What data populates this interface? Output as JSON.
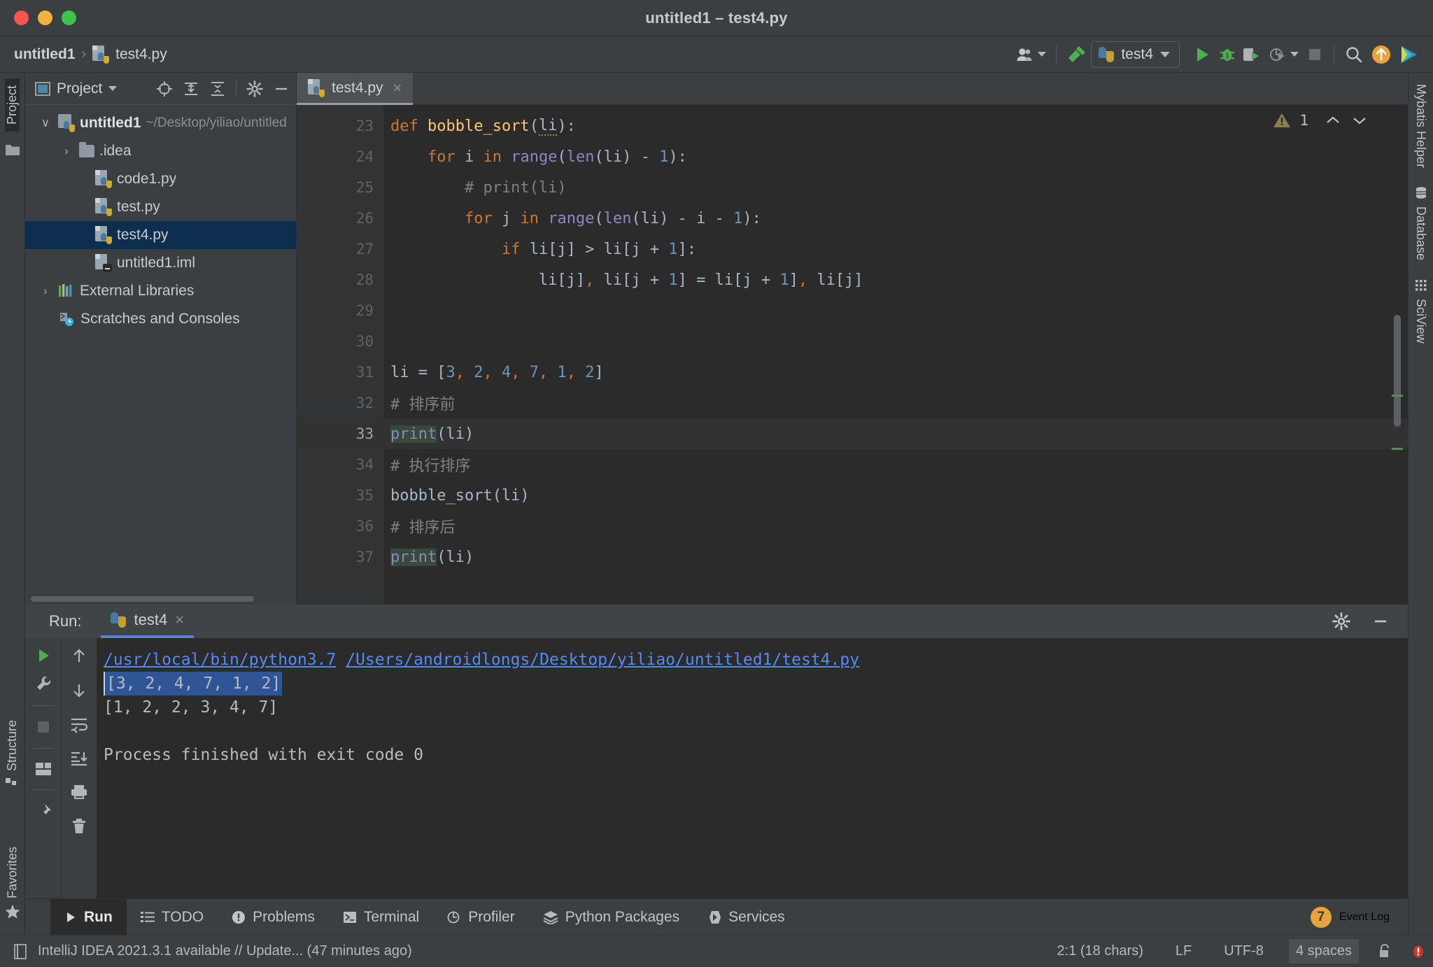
{
  "window": {
    "title": "untitled1 – test4.py",
    "traffic_lights": [
      "close",
      "minimize",
      "zoom"
    ]
  },
  "toolbar": {
    "breadcrumb": {
      "project": "untitled1",
      "separator": "›",
      "file": "test4.py"
    },
    "account_icon": "user-icon",
    "build_icon": "hammer-icon",
    "run_config": {
      "label": "test4",
      "icon": "python-icon"
    },
    "actions": [
      {
        "name": "run-button",
        "icon": "play-icon"
      },
      {
        "name": "debug-button",
        "icon": "bug-icon"
      },
      {
        "name": "run-coverage-button",
        "icon": "coverage-icon"
      },
      {
        "name": "profile-button",
        "icon": "profiler-icon"
      },
      {
        "name": "stop-button",
        "icon": "stop-icon"
      },
      {
        "name": "search-everywhere-button",
        "icon": "search-icon"
      },
      {
        "name": "update-project-button",
        "icon": "up-arrow-icon"
      },
      {
        "name": "plugin-button",
        "icon": "rainbow-icon"
      }
    ]
  },
  "left_tool_tabs": [
    {
      "label": "Project",
      "active": true
    },
    {
      "label": "Structure",
      "active": false
    },
    {
      "label": "Favorites",
      "active": false
    }
  ],
  "right_tool_tabs": [
    {
      "label": "Mybatis Helper",
      "icon": "none"
    },
    {
      "label": "Database",
      "icon": "database-icon"
    },
    {
      "label": "SciView",
      "icon": "grid-icon"
    }
  ],
  "project_panel": {
    "title": "Project",
    "icons": [
      "locate-icon",
      "expand-all-icon",
      "collapse-all-icon",
      "gear-icon",
      "hide-icon"
    ],
    "tree": [
      {
        "label": "untitled1",
        "path": "~/Desktop/yiliao/untitled",
        "icon": "python-module-icon",
        "arrow": "∨",
        "indent": 0,
        "bold": true,
        "selected": false
      },
      {
        "label": ".idea",
        "path": "",
        "icon": "folder-icon",
        "arrow": "›",
        "indent": 1,
        "bold": false,
        "selected": false
      },
      {
        "label": "code1.py",
        "path": "",
        "icon": "python-file-icon",
        "arrow": "",
        "indent": 2,
        "bold": false,
        "selected": false
      },
      {
        "label": "test.py",
        "path": "",
        "icon": "python-file-icon",
        "arrow": "",
        "indent": 2,
        "bold": false,
        "selected": false
      },
      {
        "label": "test4.py",
        "path": "",
        "icon": "python-file-icon",
        "arrow": "",
        "indent": 2,
        "bold": false,
        "selected": true
      },
      {
        "label": "untitled1.iml",
        "path": "",
        "icon": "iml-file-icon",
        "arrow": "",
        "indent": 2,
        "bold": false,
        "selected": false
      },
      {
        "label": "External Libraries",
        "path": "",
        "icon": "libraries-icon",
        "arrow": "›",
        "indent": 0,
        "bold": false,
        "selected": false
      },
      {
        "label": "Scratches and Consoles",
        "path": "",
        "icon": "scratches-icon",
        "arrow": "",
        "indent": 0,
        "bold": false,
        "selected": false
      }
    ]
  },
  "editor": {
    "tab": {
      "label": "test4.py",
      "icon": "python-file-icon",
      "close": "×"
    },
    "inspection": {
      "count": "1",
      "icon": "warning-icon",
      "up": "⌃",
      "down": "⌄"
    },
    "first_line_number": 23,
    "lines": [
      {
        "n": 23,
        "current": false,
        "fold": "minus",
        "tokens": [
          {
            "t": "def ",
            "c": "k"
          },
          {
            "t": "bobble_sort",
            "c": "fn"
          },
          {
            "t": "(",
            "c": "op"
          },
          {
            "t": "li",
            "c": "op sq"
          },
          {
            "t": "):",
            "c": "op"
          }
        ]
      },
      {
        "n": 24,
        "current": false,
        "fold": "minus",
        "tokens": [
          {
            "t": "    ",
            "c": "op"
          },
          {
            "t": "for",
            "c": "k"
          },
          {
            "t": " i ",
            "c": "op"
          },
          {
            "t": "in",
            "c": "k"
          },
          {
            "t": " ",
            "c": "op"
          },
          {
            "t": "range",
            "c": "bi"
          },
          {
            "t": "(",
            "c": "op"
          },
          {
            "t": "len",
            "c": "bi"
          },
          {
            "t": "(li) - ",
            "c": "op"
          },
          {
            "t": "1",
            "c": "num"
          },
          {
            "t": "):",
            "c": "op"
          }
        ]
      },
      {
        "n": 25,
        "current": false,
        "fold": "",
        "tokens": [
          {
            "t": "        # print(li)",
            "c": "cm"
          }
        ]
      },
      {
        "n": 26,
        "current": false,
        "fold": "minus",
        "tokens": [
          {
            "t": "        ",
            "c": "op"
          },
          {
            "t": "for",
            "c": "k"
          },
          {
            "t": " j ",
            "c": "op"
          },
          {
            "t": "in",
            "c": "k"
          },
          {
            "t": " ",
            "c": "op"
          },
          {
            "t": "range",
            "c": "bi"
          },
          {
            "t": "(",
            "c": "op"
          },
          {
            "t": "len",
            "c": "bi"
          },
          {
            "t": "(li) - i - ",
            "c": "op"
          },
          {
            "t": "1",
            "c": "num"
          },
          {
            "t": "):",
            "c": "op"
          }
        ]
      },
      {
        "n": 27,
        "current": false,
        "fold": "",
        "tokens": [
          {
            "t": "            ",
            "c": "op"
          },
          {
            "t": "if",
            "c": "k"
          },
          {
            "t": " li[j] > li[j + ",
            "c": "op"
          },
          {
            "t": "1",
            "c": "num"
          },
          {
            "t": "]:",
            "c": "op"
          }
        ]
      },
      {
        "n": 28,
        "current": false,
        "fold": "end",
        "tokens": [
          {
            "t": "                li[j]",
            "c": "op"
          },
          {
            "t": ",",
            "c": "cma"
          },
          {
            "t": " li[j + ",
            "c": "op"
          },
          {
            "t": "1",
            "c": "num"
          },
          {
            "t": "] = li[j + ",
            "c": "op"
          },
          {
            "t": "1",
            "c": "num"
          },
          {
            "t": "]",
            "c": "op"
          },
          {
            "t": ",",
            "c": "cma"
          },
          {
            "t": " li[j]",
            "c": "op"
          }
        ]
      },
      {
        "n": 29,
        "current": false,
        "fold": "",
        "tokens": []
      },
      {
        "n": 30,
        "current": false,
        "fold": "",
        "tokens": []
      },
      {
        "n": 31,
        "current": false,
        "fold": "",
        "tokens": [
          {
            "t": "li = [",
            "c": "op"
          },
          {
            "t": "3",
            "c": "num"
          },
          {
            "t": ",",
            "c": "cma"
          },
          {
            "t": " ",
            "c": "op"
          },
          {
            "t": "2",
            "c": "num"
          },
          {
            "t": ",",
            "c": "cma"
          },
          {
            "t": " ",
            "c": "op"
          },
          {
            "t": "4",
            "c": "num"
          },
          {
            "t": ",",
            "c": "cma"
          },
          {
            "t": " ",
            "c": "op"
          },
          {
            "t": "7",
            "c": "num"
          },
          {
            "t": ",",
            "c": "cma"
          },
          {
            "t": " ",
            "c": "op"
          },
          {
            "t": "1",
            "c": "num"
          },
          {
            "t": ",",
            "c": "cma"
          },
          {
            "t": " ",
            "c": "op"
          },
          {
            "t": "2",
            "c": "num"
          },
          {
            "t": "]",
            "c": "op"
          }
        ]
      },
      {
        "n": 32,
        "current": false,
        "fold": "",
        "tokens": [
          {
            "t": "# 排序前",
            "c": "cm"
          }
        ]
      },
      {
        "n": 33,
        "current": true,
        "fold": "",
        "tokens": [
          {
            "t": "print",
            "c": "bi hl"
          },
          {
            "t": "(li)",
            "c": "op"
          }
        ]
      },
      {
        "n": 34,
        "current": false,
        "fold": "",
        "tokens": [
          {
            "t": "# 执行排序",
            "c": "cm"
          }
        ]
      },
      {
        "n": 35,
        "current": false,
        "fold": "",
        "tokens": [
          {
            "t": "bobble_sort(li)",
            "c": "op"
          }
        ]
      },
      {
        "n": 36,
        "current": false,
        "fold": "",
        "tokens": [
          {
            "t": "# 排序后",
            "c": "cm"
          }
        ]
      },
      {
        "n": 37,
        "current": false,
        "fold": "",
        "tokens": [
          {
            "t": "print",
            "c": "bi hl"
          },
          {
            "t": "(li)",
            "c": "op"
          }
        ]
      }
    ]
  },
  "run_window": {
    "label": "Run:",
    "tab": {
      "label": "test4",
      "icon": "python-icon",
      "close": "×"
    },
    "header_icons": [
      "gear-icon",
      "hide-icon"
    ],
    "toolbar_left": [
      "rerun-icon",
      "wrench-icon",
      "stop-icon",
      "layout-icon",
      "pin-icon"
    ],
    "toolbar_right": [
      "up-icon",
      "down-icon",
      "soft-wrap-icon",
      "scroll-to-end-icon",
      "print-icon",
      "trash-icon"
    ],
    "console": {
      "command": "/usr/local/bin/python3.7 /Users/androidlongs/Desktop/yiliao/untitled1/test4.py",
      "command_parts": [
        "/usr/local/bin/python3.7",
        "/Users/androidlongs/Desktop/yiliao/untitled1/test4.py"
      ],
      "output_selected": "[3, 2, 4, 7, 1, 2]",
      "output_line2": "[1, 2, 2, 3, 4, 7]",
      "exit_message": "Process finished with exit code 0"
    }
  },
  "bottom_bar": {
    "buttons": [
      {
        "label": "Run",
        "icon": "play-icon",
        "active": true
      },
      {
        "label": "TODO",
        "icon": "list-icon",
        "active": false
      },
      {
        "label": "Problems",
        "icon": "exclamation-icon",
        "active": false
      },
      {
        "label": "Terminal",
        "icon": "terminal-icon",
        "active": false
      },
      {
        "label": "Profiler",
        "icon": "profiler-icon",
        "active": false
      },
      {
        "label": "Python Packages",
        "icon": "packages-icon",
        "active": false
      },
      {
        "label": "Services",
        "icon": "services-icon",
        "active": false
      }
    ],
    "event_log": {
      "label": "Event Log",
      "count": "7"
    }
  },
  "status_bar": {
    "icon": "memory-icon",
    "message": "IntelliJ IDEA 2021.3.1 available // Update... (47 minutes ago)",
    "caret": "2:1 (18 chars)",
    "line_sep": "LF",
    "encoding": "UTF-8",
    "indent": "4 spaces",
    "lock_icon": "unlocked-icon",
    "inspection_icon": "inspection-icon"
  },
  "colors": {
    "accent_blue": "#4a88c7",
    "selection_blue": "#0d2e4e",
    "editor_bg": "#2b2b2b",
    "panel_bg": "#3c3f41",
    "keyword": "#cc7832",
    "number": "#6897bb",
    "function": "#ffc66d",
    "builtin": "#8888c6",
    "comment": "#808080"
  }
}
